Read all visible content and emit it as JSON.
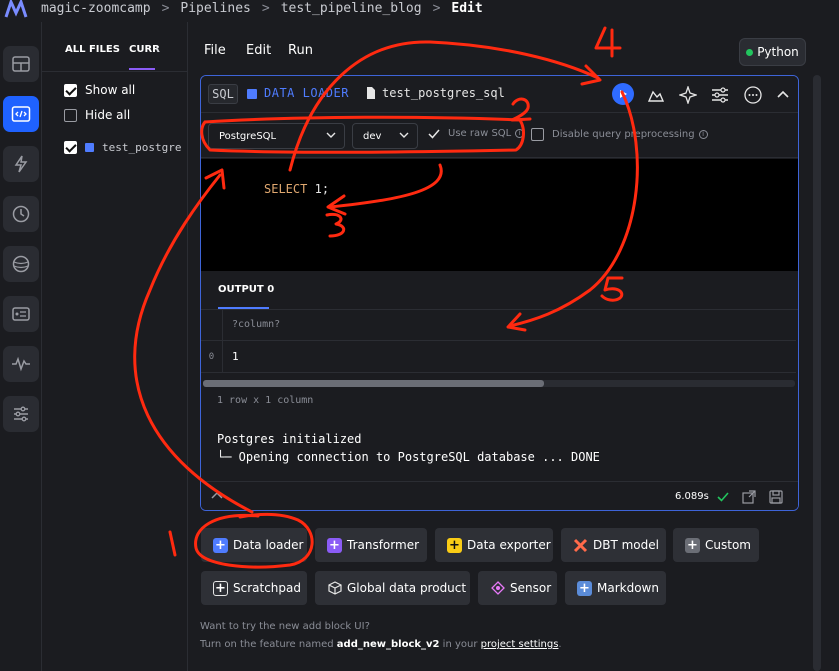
{
  "breadcrumbs": {
    "root": "magic-zoomcamp",
    "pipelines": "Pipelines",
    "pipeline": "test_pipeline_blog",
    "current": "Edit"
  },
  "file_panel": {
    "tab_all": "ALL FILES",
    "tab_current": "CURR",
    "show_all": "Show all",
    "hide_all": "Hide all",
    "file_name": "test_postgre"
  },
  "menu": {
    "file": "File",
    "edit": "Edit",
    "run": "Run"
  },
  "kernel": "Python",
  "block": {
    "lang_tag": "SQL",
    "type_label": "DATA LOADER",
    "name": "test_postgres_sql",
    "connection": "PostgreSQL",
    "profile": "dev",
    "use_raw_sql": "Use raw SQL",
    "disable_preprocessing": "Disable query preprocessing",
    "code_keyword": "SELECT",
    "code_value": "1;",
    "output_tab": "OUTPUT 0",
    "column_header": "?column?",
    "row_index": "0",
    "cell_value": "1",
    "row_count": "1 row x 1 column",
    "log_line_1": "Postgres initialized",
    "log_line_2": "└─ Opening connection to PostgreSQL database ... DONE",
    "runtime": "6.089s"
  },
  "add_blocks": {
    "data_loader": "Data loader",
    "transformer": "Transformer",
    "data_exporter": "Data exporter",
    "dbt_model": "DBT model",
    "custom": "Custom",
    "scratchpad": "Scratchpad",
    "global_data_product": "Global data product",
    "sensor": "Sensor",
    "markdown": "Markdown"
  },
  "tip": {
    "line1": "Want to try the new add block UI?",
    "line2_prefix": "Turn on the feature named ",
    "feature_name": "add_new_block_v2",
    "line2_mid": " in your ",
    "link": "project settings",
    "line2_end": "."
  },
  "annotations": {
    "n1": "1",
    "n2": "2",
    "n3": "3",
    "n4": "4",
    "n5": "5"
  },
  "colors": {
    "accent": "#1f62ff",
    "block_blue": "#4f7cff",
    "annotation_red": "#ff2a10",
    "kernel_dot": "#22c55e"
  }
}
